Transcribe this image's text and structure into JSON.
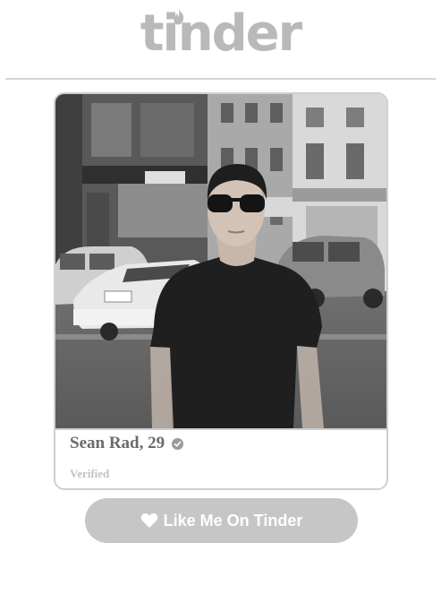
{
  "header": {
    "logo_text": "tinder",
    "logo_icon": "flame-icon"
  },
  "profile": {
    "name_age": "Sean Rad, 29",
    "verified_icon": "check-badge-icon",
    "status": "Verified",
    "photo_description_icon": "profile-photo"
  },
  "cta": {
    "label": "Like Me On Tinder",
    "icon": "heart-icon"
  },
  "colors": {
    "logo": "#b9b9b9",
    "button_bg": "#c6c6c6",
    "button_text": "#ffffff",
    "card_border": "#cfcfd4",
    "name_text": "#6a6a6a",
    "verified_text": "#c2c2c2"
  }
}
